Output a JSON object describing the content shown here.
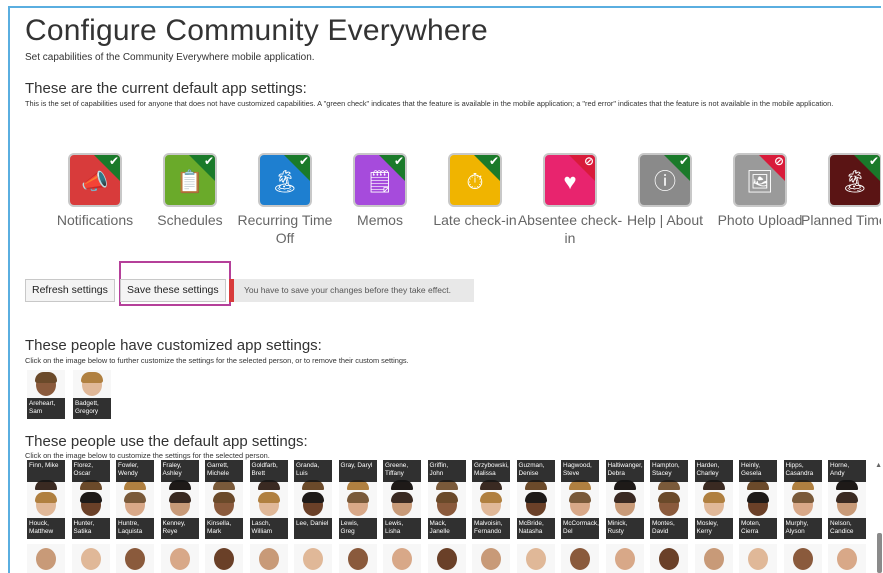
{
  "page": {
    "title": "Configure Community Everywhere",
    "subtitle": "Set capabilities of the Community Everywhere mobile application."
  },
  "defaults": {
    "heading": "These are the current default app settings:",
    "description": "This is the set of capabilities used for anyone that does not have customized capabilities. A \"green check\" indicates that the feature is available in the mobile application; a \"red error\" indicates that the feature is not available in the mobile application."
  },
  "features": [
    {
      "label": "Notifications",
      "icon": "megaphone-icon",
      "glyph": "📣",
      "color": "#d83b3b",
      "enabled": true,
      "mark": "✔"
    },
    {
      "label": "Schedules",
      "icon": "clipboard-icon",
      "glyph": "📋",
      "color": "#6aaa2a",
      "enabled": true,
      "mark": "✔"
    },
    {
      "label": "Recurring Time Off",
      "icon": "palm-tree-icon",
      "glyph": "🏝",
      "color": "#1e7fd0",
      "enabled": true,
      "mark": "✔"
    },
    {
      "label": "Memos",
      "icon": "memo-icon",
      "glyph": "🗒",
      "color": "#a64bdc",
      "enabled": true,
      "mark": "✔"
    },
    {
      "label": "Late check-in",
      "icon": "stopwatch-icon",
      "glyph": "⏱",
      "color": "#f0b400",
      "enabled": true,
      "mark": "✔"
    },
    {
      "label": "Absentee check-in",
      "icon": "heartbeat-icon",
      "glyph": "♥",
      "color": "#e8246e",
      "enabled": false,
      "mark": "⊘"
    },
    {
      "label": "Help | About",
      "icon": "info-icon",
      "glyph": "ⓘ",
      "color": "#8a8a8a",
      "enabled": true,
      "mark": "✔"
    },
    {
      "label": "Photo Upload",
      "icon": "photo-icon",
      "glyph": "🖼",
      "color": "#9a9a9a",
      "enabled": false,
      "mark": "⊘"
    },
    {
      "label": "Planned Time Off",
      "icon": "palm-tree-icon",
      "glyph": "🏝",
      "color": "#5a1414",
      "enabled": true,
      "mark": "✔"
    }
  ],
  "actions": {
    "refresh_label": "Refresh settings",
    "save_label": "Save these settings",
    "notice": "You have to save your changes before they take effect."
  },
  "customized": {
    "heading": "These people have customized app settings:",
    "description": "Click on the image below to further customize the settings for the selected person, or to remove their custom settings.",
    "people": [
      "Areheart, Sam",
      "Badgett, Gregory"
    ]
  },
  "default_people": {
    "heading": "These people use the default app settings:",
    "description": "Click on the image below to customize the settings for the selected person.",
    "row1": [
      "Finn, Mike",
      "Florez, Oscar",
      "Fowler, Wendy",
      "Fraley, Ashley",
      "Garrett, Michele",
      "Goldfarb, Brett",
      "Granda, Luis",
      "Gray, Daryl",
      "Greene, Tiffany",
      "Griffin, John",
      "Grzybowski, Malissa",
      "Guzman, Denise",
      "Hagwood, Steve",
      "Haltiwanger, Debra",
      "Hampton, Stacey",
      "Harden, Charley",
      "Heinly, Gesela",
      "Hipps, Casandra",
      "Horne, Andy"
    ],
    "row2": [
      "Houck, Matthew",
      "Hunter, Satika",
      "Huntre, Laquista",
      "Kenney, Reye",
      "Kinsella, Mark",
      "Lasch, William",
      "Lee, Daniel",
      "Lewis, Greg",
      "Lewis, Lisha",
      "Mack, Janelle",
      "Malvoisin, Fernando",
      "McBride, Natasha",
      "McCormack, Del",
      "Minick, Rusty",
      "Montes, David",
      "Mosley, Kerry",
      "Moten, Cierra",
      "Murphy, Alyson",
      "Nelson, Candice"
    ]
  }
}
